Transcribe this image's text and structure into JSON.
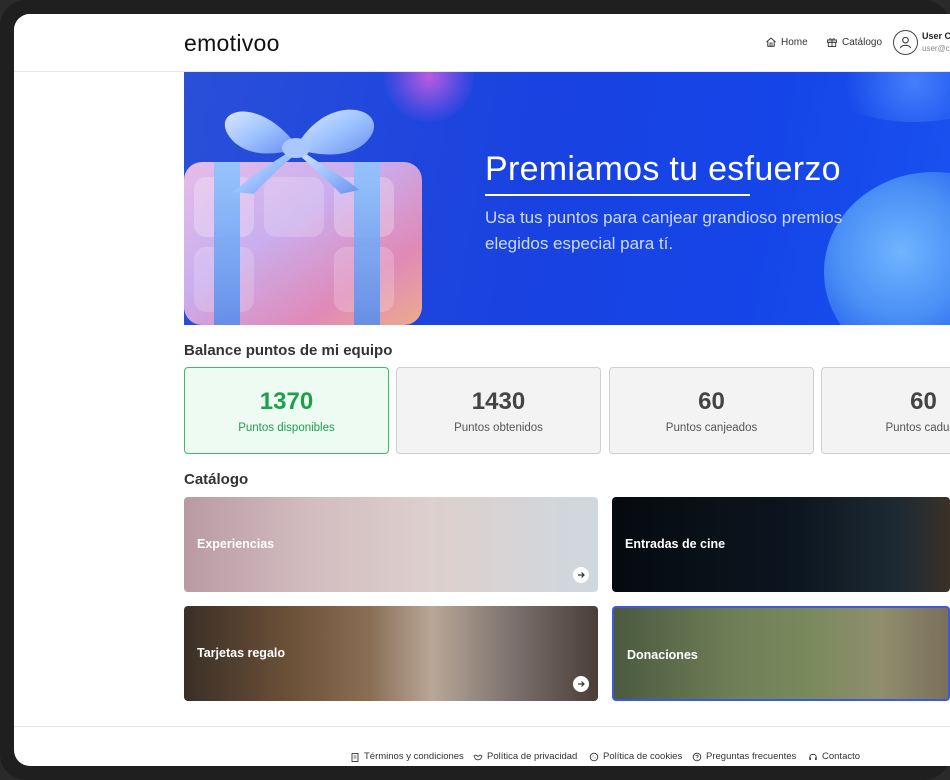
{
  "header": {
    "logo": "emotivoo",
    "nav": {
      "home": "Home",
      "catalog": "Catálogo"
    },
    "user": {
      "name": "User C",
      "email": "user@c"
    }
  },
  "hero": {
    "title": "Premiamos tu esfuerzo",
    "subtitle": "Usa tus puntos para canjear grandioso premios elegidos especial para tí."
  },
  "balance": {
    "title": "Balance puntos de mi equipo",
    "cards": [
      {
        "value": "1370",
        "label": "Puntos disponibles"
      },
      {
        "value": "1430",
        "label": "Puntos obtenidos"
      },
      {
        "value": "60",
        "label": "Puntos canjeados"
      },
      {
        "value": "60",
        "label": "Puntos caduca"
      }
    ]
  },
  "catalog": {
    "title": "Catálogo",
    "tiles": [
      {
        "label": "Experiencias"
      },
      {
        "label": "Entradas de cine"
      },
      {
        "label": "Tarjetas regalo"
      },
      {
        "label": "Donaciones"
      }
    ]
  },
  "footer": {
    "links": [
      {
        "label": "Términos y condiciones"
      },
      {
        "label": "Política de privacidad"
      },
      {
        "label": "Política de cookies"
      },
      {
        "label": "Preguntas frecuentes"
      },
      {
        "label": "Contacto"
      }
    ]
  },
  "colors": {
    "accent_green": "#1f9e4e",
    "hero_blue": "#1942e0",
    "selected_border": "#3d5ad8"
  }
}
